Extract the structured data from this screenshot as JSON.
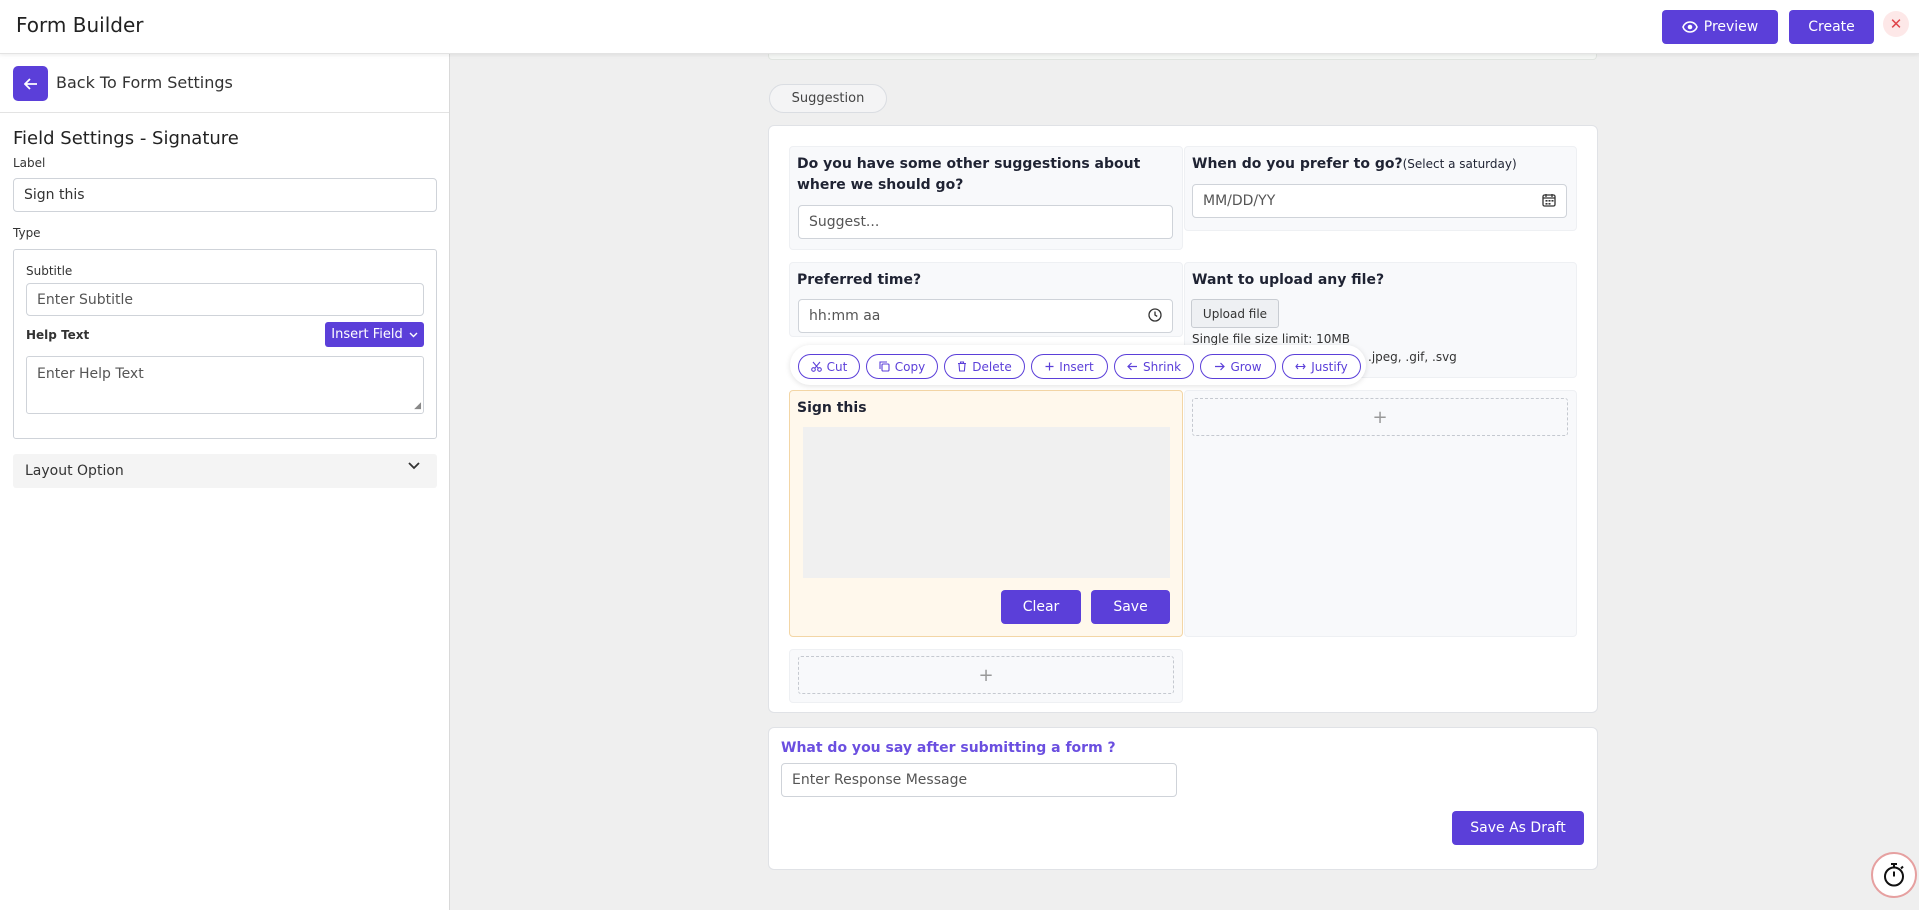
{
  "header": {
    "title": "Form Builder",
    "preview_label": "Preview",
    "create_label": "Create",
    "close_glyph": "✕"
  },
  "sidebar": {
    "back_label": "Back To Form Settings",
    "title": "Field Settings - Signature",
    "label_caption": "Label",
    "label_value": "Sign this",
    "type_caption": "Type",
    "subtitle_caption": "Subtitle",
    "subtitle_placeholder": "Enter Subtitle",
    "help_caption": "Help Text",
    "insert_field_label": "Insert Field",
    "help_placeholder": "Enter Help Text",
    "layout_option": "Layout Option"
  },
  "form": {
    "section_tab": "Suggestion",
    "q1": {
      "label": "Do you have some other suggestions about where we should go?",
      "placeholder": "Suggest..."
    },
    "q2": {
      "label": "When do you prefer to go?",
      "sub": "(Select a saturday)",
      "placeholder": "MM/DD/YY"
    },
    "q3": {
      "label": "Preferred time?",
      "placeholder": "hh:mm aa"
    },
    "q4": {
      "label": "Want to upload any file?",
      "button": "Upload file",
      "limit": "Single file size limit: 10MB",
      "types": ".jpeg, .gif, .svg"
    },
    "toolbar": {
      "cut": "Cut",
      "copy": "Copy",
      "delete": "Delete",
      "insert": "Insert",
      "shrink": "Shrink",
      "grow": "Grow",
      "justify": "Justify"
    },
    "signature": {
      "label": "Sign this",
      "clear": "Clear",
      "save": "Save"
    },
    "add_glyph": "+"
  },
  "response": {
    "label": "What do you say after submitting a form ?",
    "placeholder": "Enter Response Message",
    "save_draft": "Save As Draft"
  },
  "colors": {
    "accent": "#5b3fd9",
    "signature_bg": "#fff8ec"
  },
  "icons": [
    "eye-icon",
    "close-icon",
    "arrow-left-icon",
    "chevron-down-icon",
    "calendar-icon",
    "clock-icon",
    "scissors-icon",
    "copy-icon",
    "trash-icon",
    "plus-icon",
    "arrow-right-icon",
    "justify-icon",
    "stopwatch-icon"
  ]
}
